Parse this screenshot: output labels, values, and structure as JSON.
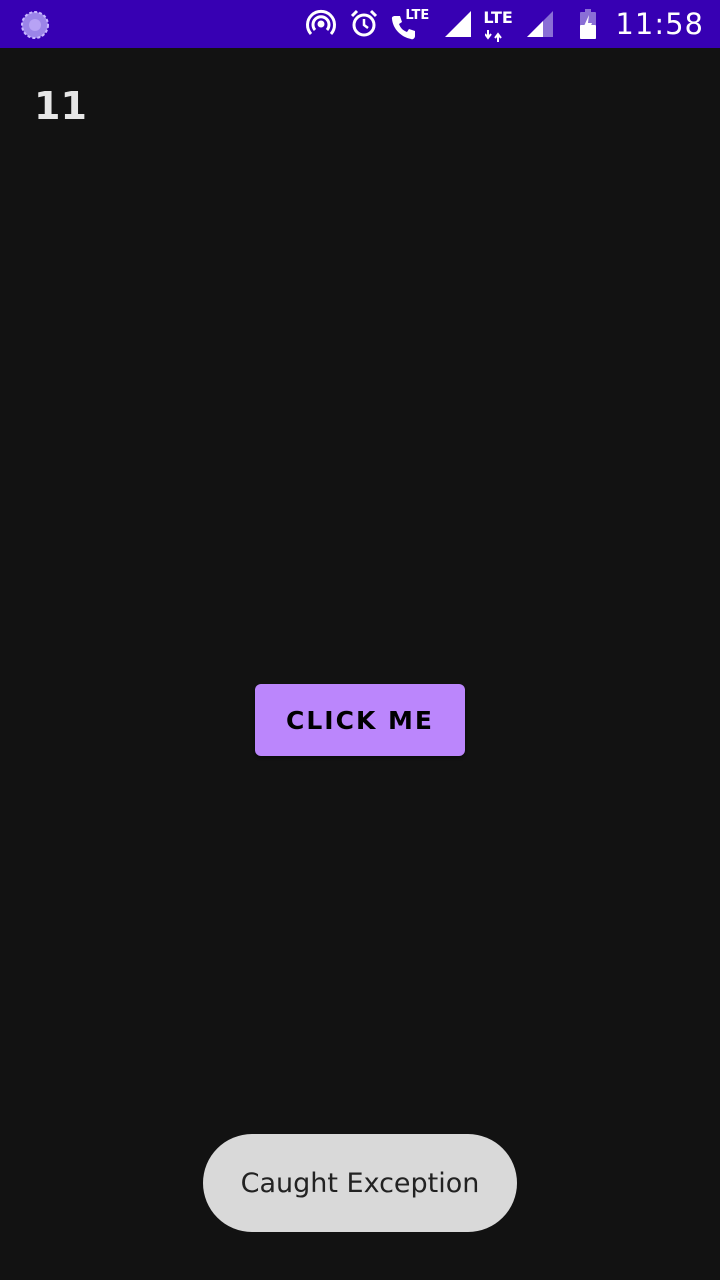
{
  "status_bar": {
    "time": "11:58",
    "lte_label_1": "LTE",
    "lte_label_2": "LTE",
    "background_color": "#3700B3",
    "icons": [
      "app-notification-icon",
      "hotspot-icon",
      "alarm-icon",
      "volte-call-icon",
      "signal-icon",
      "data-arrows-icon",
      "signal-icon-2",
      "battery-charging-icon"
    ]
  },
  "main": {
    "counter_value": "11",
    "button_label": "CLICK ME",
    "button_color": "#BB86FC",
    "background_color": "#121212"
  },
  "toast": {
    "message": "Caught Exception"
  }
}
